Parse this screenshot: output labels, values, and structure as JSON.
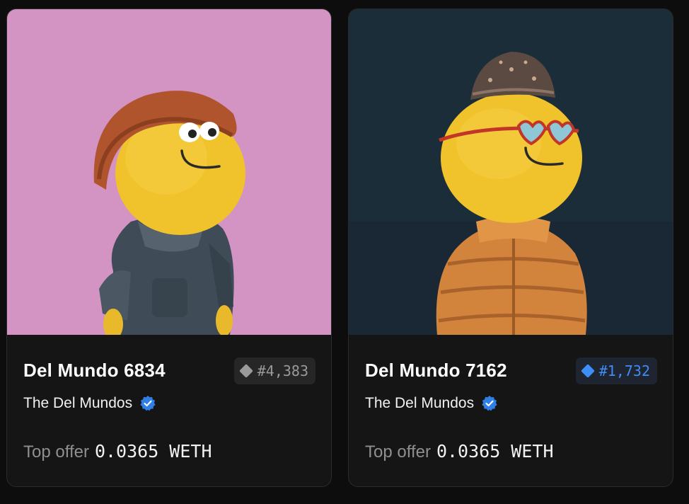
{
  "colors": {
    "page_bg": "#0d0d0d",
    "card_bg": "#151515",
    "rank_grey": "#9a9a9a",
    "rank_blue": "#3d8ff5",
    "verified_blue": "#2f7fe6"
  },
  "cards": [
    {
      "name": "Del Mundo 6834",
      "rank": "#4,383",
      "rank_style": "grey",
      "collection": "The Del Mundos",
      "verified_icon": "verified-badge-icon",
      "top_offer_label": "Top offer",
      "top_offer_value": "0.0365 WETH",
      "image_background": "#d79ac8"
    },
    {
      "name": "Del Mundo 7162",
      "rank": "#1,732",
      "rank_style": "blue",
      "collection": "The Del Mundos",
      "verified_icon": "verified-badge-icon",
      "top_offer_label": "Top offer",
      "top_offer_value": "0.0365 WETH",
      "image_background": "#1c2d3a"
    }
  ]
}
